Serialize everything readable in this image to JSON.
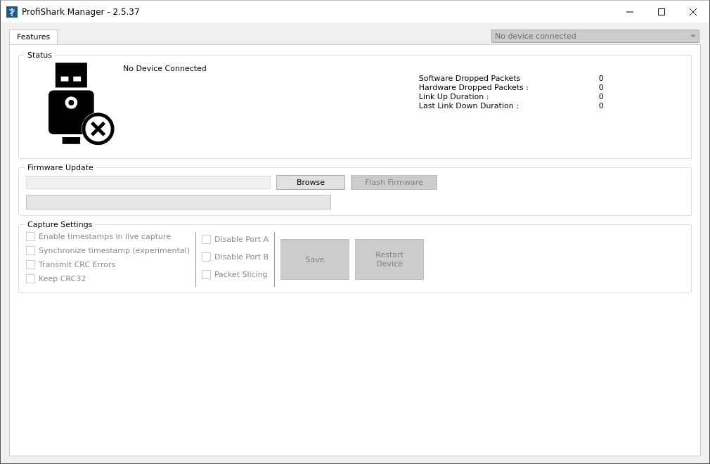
{
  "window": {
    "title": "ProfiShark Manager - 2.5.37"
  },
  "tabs": [
    {
      "label": "Features",
      "selected": true
    }
  ],
  "device_select": {
    "value": "No device connected",
    "disabled": true
  },
  "status": {
    "title": "Status",
    "message": "No Device Connected",
    "stats": [
      {
        "label": "Software Dropped Packets",
        "value": "0"
      },
      {
        "label": "Hardware Dropped Packets :",
        "value": "0"
      },
      {
        "label": "Link Up Duration :",
        "value": "0"
      },
      {
        "label": "Last Link Down Duration :",
        "value": "0"
      }
    ]
  },
  "firmware": {
    "title": "Firmware Update",
    "progress": {
      "level": 0
    },
    "buttons": [
      {
        "label": "Browse",
        "disabled": false
      },
      {
        "label": "Flash Firmware",
        "disabled": true
      }
    ]
  },
  "capture": {
    "title": "Capture Settings",
    "options_left": [
      {
        "label": "Enable timestamps in live capture",
        "checked": false,
        "disabled": true
      },
      {
        "label": "Synchronize timestamp (experimental)",
        "checked": false,
        "disabled": true
      },
      {
        "label": "Transmit CRC Errors",
        "checked": false,
        "disabled": true
      },
      {
        "label": "Keep CRC32",
        "checked": false,
        "disabled": true
      }
    ],
    "options_right": [
      {
        "label": "Disable Port A",
        "checked": false,
        "disabled": true
      },
      {
        "label": "Disable Port B",
        "checked": false,
        "disabled": true
      },
      {
        "label": "Packet Slicing",
        "checked": false,
        "disabled": true
      }
    ],
    "buttons": [
      {
        "label": "Save",
        "disabled": true
      },
      {
        "label": "Restart\nDevice",
        "disabled": true
      }
    ]
  }
}
